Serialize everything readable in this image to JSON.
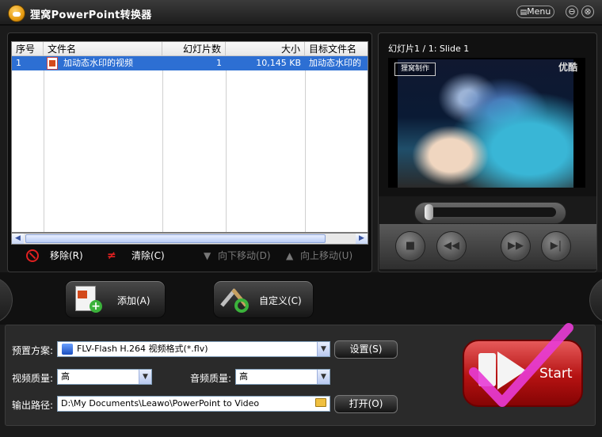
{
  "window": {
    "title": "狸窝PowerPoint转换器",
    "menu_label": "Menu",
    "minimize_glyph": "⊖",
    "close_glyph": "⊗"
  },
  "file_table": {
    "columns": [
      "序号",
      "文件名",
      "幻灯片数",
      "大小",
      "目标文件名"
    ],
    "rows": [
      {
        "index": "1",
        "name": "加动态水印的视频",
        "slides": "1",
        "size": "10,145 KB",
        "target": "加动态水印的"
      }
    ]
  },
  "list_actions": {
    "remove": "移除(R)",
    "clear": "清除(C)",
    "move_down": "向下移动(D)",
    "move_up": "向上移动(U)"
  },
  "preview": {
    "slide_label": "幻灯片1 / 1: Slide 1",
    "watermark_left": "狸窝制作",
    "watermark_right": "优酷"
  },
  "main_buttons": {
    "add": "添加(A)",
    "customize": "自定义(C)"
  },
  "settings": {
    "preset_label": "预置方案:",
    "preset_value": "FLV-Flash H.264 视频格式(*.flv)",
    "settings_button": "设置(S)",
    "video_quality_label": "视频质量:",
    "video_quality_value": "高",
    "audio_quality_label": "音频质量:",
    "audio_quality_value": "高",
    "output_label": "输出路径:",
    "output_value": "D:\\My Documents\\Leawo\\PowerPoint to Video",
    "open_button": "打开(O)",
    "start_label": "Start"
  },
  "colors": {
    "selection": "#2d6fd3",
    "start_red": "#c51a1a",
    "checkmark": "#e83cd6"
  }
}
